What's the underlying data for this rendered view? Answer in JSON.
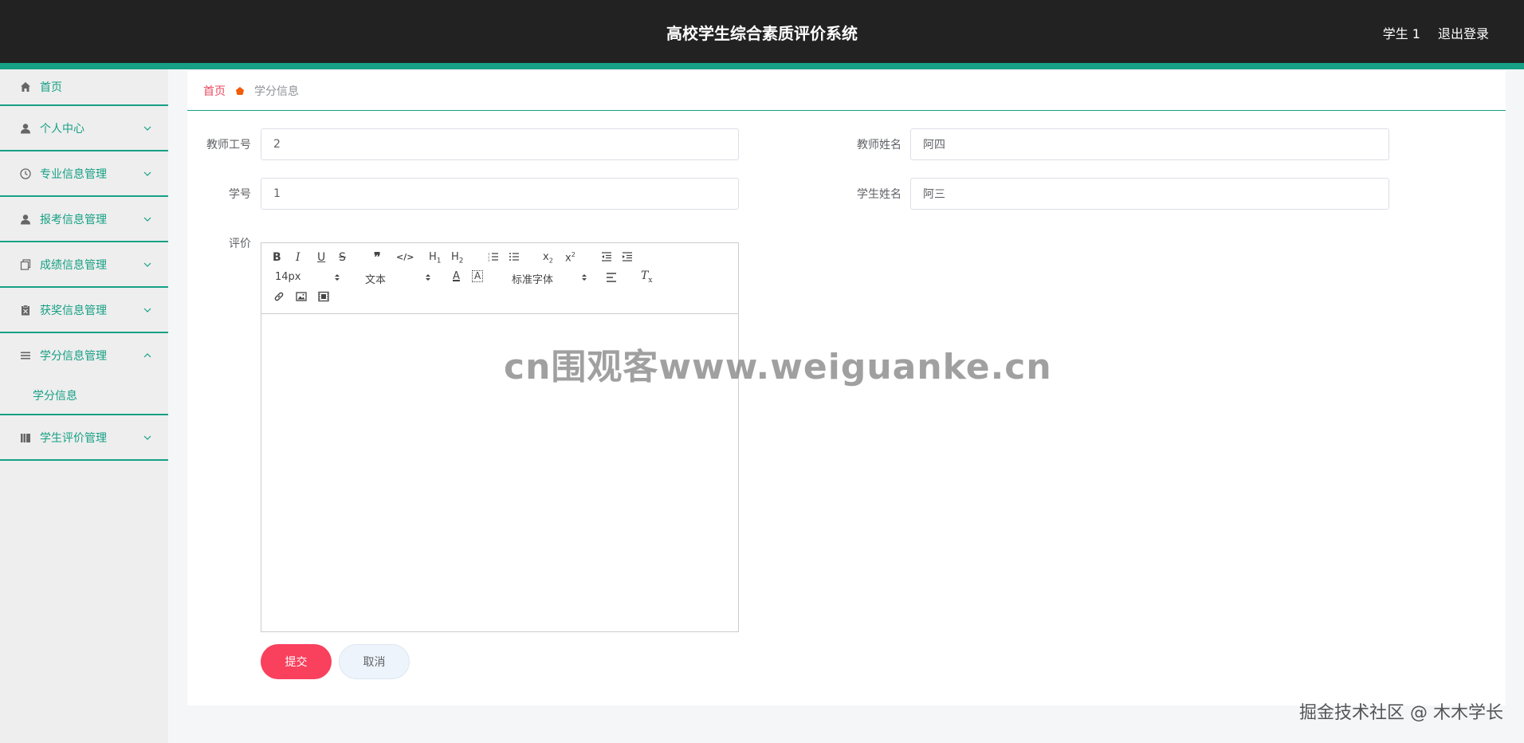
{
  "header": {
    "title": "高校学生综合素质评价系统",
    "user": "学生 1",
    "logout": "退出登录"
  },
  "sidebar": {
    "items": [
      {
        "label": "首页",
        "icon": "home-icon"
      },
      {
        "label": "个人中心",
        "icon": "user-icon"
      },
      {
        "label": "专业信息管理",
        "icon": "clock-icon"
      },
      {
        "label": "报考信息管理",
        "icon": "user-icon"
      },
      {
        "label": "成绩信息管理",
        "icon": "copy-icon"
      },
      {
        "label": "获奖信息管理",
        "icon": "clipboard-icon"
      },
      {
        "label": "学分信息管理",
        "icon": "list-icon"
      },
      {
        "label": "学生评价管理",
        "icon": "book-icon"
      }
    ],
    "submenu": {
      "label": "学分信息"
    }
  },
  "breadcrumb": {
    "home": "首页",
    "current": "学分信息"
  },
  "form": {
    "teacher_id_label": "教师工号",
    "teacher_id_value": "2",
    "teacher_name_label": "教师姓名",
    "teacher_name_value": "阿四",
    "student_id_label": "学号",
    "student_id_value": "1",
    "student_name_label": "学生姓名",
    "student_name_value": "阿三",
    "comment_label": "评价"
  },
  "editor": {
    "font_size": "14px",
    "header_type": "文本",
    "font_family": "标准字体"
  },
  "buttons": {
    "submit": "提交",
    "cancel": "取消"
  },
  "watermark": "cn围观客www.weiguanke.cn",
  "corner_mark": "掘金技术社区 @ 木木学长",
  "colors": {
    "header_bg": "#222222",
    "accent": "#16a085",
    "submit": "#f9405d",
    "breadcrumb_home": "#e84a5f"
  }
}
